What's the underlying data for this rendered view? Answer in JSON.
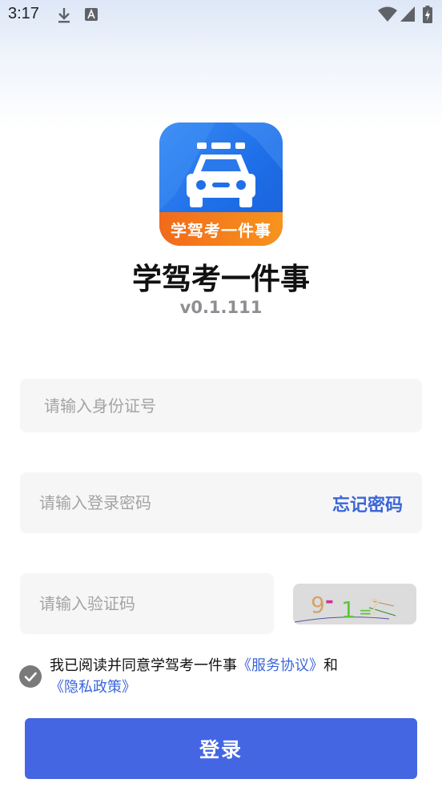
{
  "status_bar": {
    "time": "3:17",
    "icons": [
      "download-icon",
      "font-a-icon",
      "wifi-icon",
      "signal-icon",
      "battery-charging-icon"
    ]
  },
  "app": {
    "logo_text": "学驾考一件事",
    "name": "学驾考一件事",
    "version": "v0.1.111"
  },
  "form": {
    "id_placeholder": "请输入身份证号",
    "password_placeholder": "请输入登录密码",
    "forgot_password": "忘记密码",
    "captcha_placeholder": "请输入验证码",
    "captcha_text": {
      "a": "9",
      "op": "-",
      "b": "1",
      "eq": "=",
      "q": "?"
    }
  },
  "agreement": {
    "prefix": "我已阅读并同意学驾考一件事",
    "service_link": "《服务协议》",
    "conjunction": "和",
    "privacy_link": "《隐私政策》"
  },
  "login_button": "登录",
  "colors": {
    "primary": "#4466e3",
    "link": "#3b66d9",
    "logo_blue": "#1e6fe8",
    "logo_orange": "#f7941d"
  }
}
